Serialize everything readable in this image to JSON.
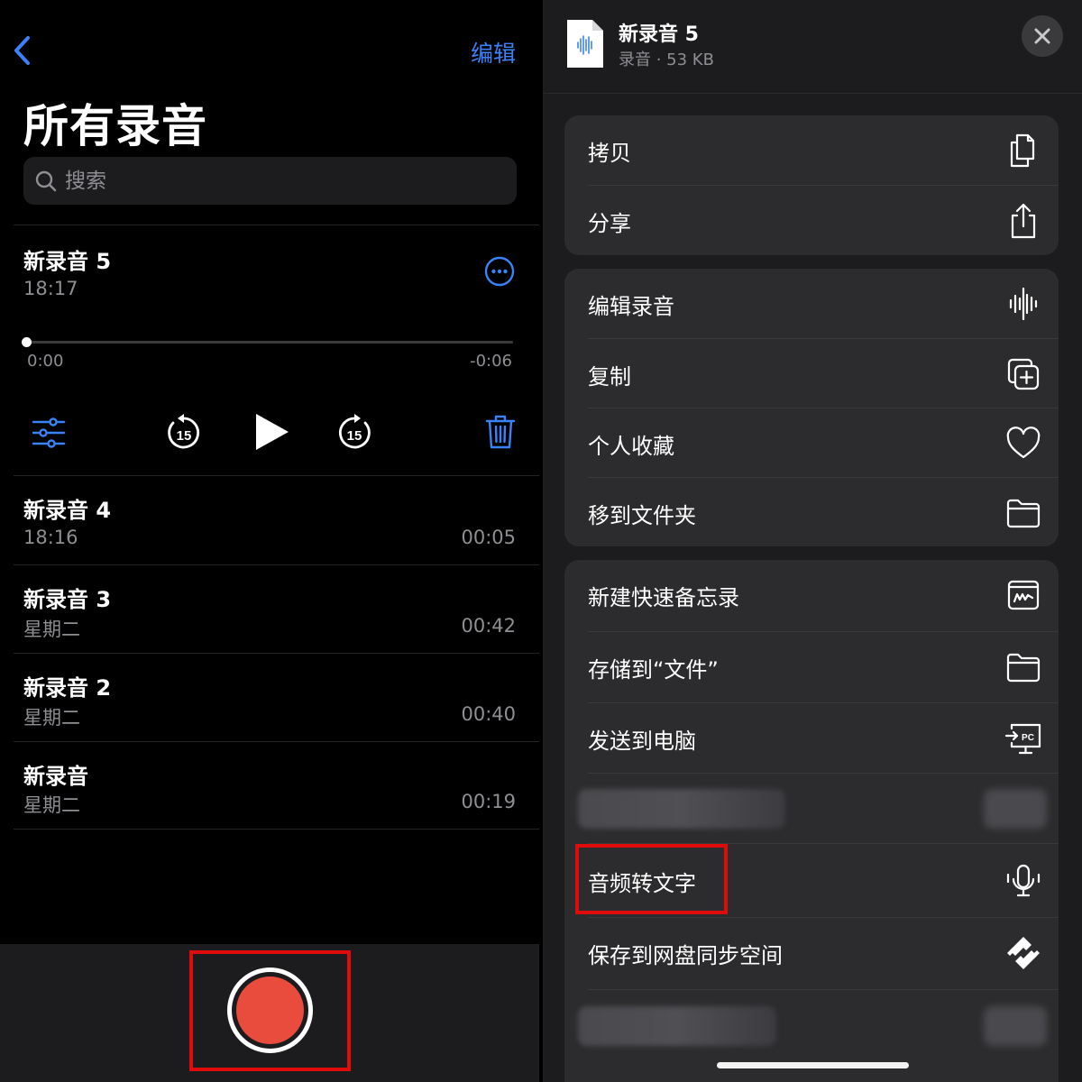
{
  "left": {
    "edit_label": "编辑",
    "page_title": "所有录音",
    "search_placeholder": "搜索",
    "expanded": {
      "title": "新录音 5",
      "time": "18:17",
      "progress_start": "0:00",
      "progress_end": "-0:06",
      "progress": 0
    },
    "recordings": [
      {
        "title": "新录音 4",
        "date": "18:16",
        "duration": "00:05"
      },
      {
        "title": "新录音 3",
        "date": "星期二",
        "duration": "00:42"
      },
      {
        "title": "新录音 2",
        "date": "星期二",
        "duration": "00:40"
      },
      {
        "title": "新录音",
        "date": "星期二",
        "duration": "00:19"
      }
    ],
    "accent_color": "#3a82f7",
    "record_color": "#e94b3c"
  },
  "right": {
    "file_title": "新录音 5",
    "file_meta": "录音 · 53 KB",
    "group1": [
      {
        "label": "拷贝",
        "icon": "copy-icon"
      },
      {
        "label": "分享",
        "icon": "share-icon"
      }
    ],
    "group2": [
      {
        "label": "编辑录音",
        "icon": "waveform-icon"
      },
      {
        "label": "复制",
        "icon": "duplicate-icon"
      },
      {
        "label": "个人收藏",
        "icon": "heart-icon"
      },
      {
        "label": "移到文件夹",
        "icon": "folder-icon"
      }
    ],
    "group3": [
      {
        "label": "新建快速备忘录",
        "icon": "quick-note-icon"
      },
      {
        "label": "存储到“文件”",
        "icon": "folder-icon"
      },
      {
        "label": "发送到电脑",
        "icon": "send-to-pc-icon"
      },
      {
        "label": "音频转文字",
        "icon": "microphone-icon"
      },
      {
        "label": "保存到网盘同步空间",
        "icon": "cloud-sync-icon"
      }
    ]
  }
}
